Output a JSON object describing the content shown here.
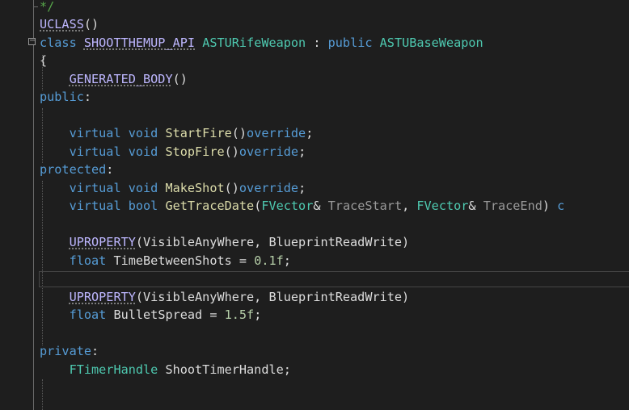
{
  "editor": {
    "colors": {
      "background": "#1e1e1e",
      "keyword": "#569cd6",
      "type": "#4ec9b0",
      "function": "#dcdcaa",
      "macro": "#beb7ff",
      "number": "#b5cea8",
      "parameter": "#9a9a9a",
      "comment": "#57a64a",
      "text": "#dcdcdc"
    },
    "lines": [
      [
        {
          "t": "*/",
          "c": "comment"
        }
      ],
      [
        {
          "t": "UCLASS",
          "c": "macro",
          "sq": true
        },
        {
          "t": "()",
          "c": "plain"
        }
      ],
      [
        {
          "t": "class ",
          "c": "kw"
        },
        {
          "t": "SHOOTTHEMUP_API",
          "c": "macro",
          "sq": true
        },
        {
          "t": " ",
          "c": "plain"
        },
        {
          "t": "ASTURifeWeapon",
          "c": "type"
        },
        {
          "t": " : ",
          "c": "plain"
        },
        {
          "t": "public ",
          "c": "kw"
        },
        {
          "t": "ASTUBaseWeapon",
          "c": "type"
        }
      ],
      [
        {
          "t": "{",
          "c": "plain"
        }
      ],
      [
        {
          "t": "    ",
          "c": "plain"
        },
        {
          "t": "GENERATED_BODY",
          "c": "macro",
          "sq": true
        },
        {
          "t": "()",
          "c": "plain"
        }
      ],
      [
        {
          "t": "public",
          "c": "kw"
        },
        {
          "t": ":",
          "c": "plain"
        }
      ],
      [],
      [
        {
          "t": "    ",
          "c": "plain"
        },
        {
          "t": "virtual void ",
          "c": "kw"
        },
        {
          "t": "StartFire",
          "c": "fn"
        },
        {
          "t": "()",
          "c": "plain"
        },
        {
          "t": "override",
          "c": "kw"
        },
        {
          "t": ";",
          "c": "plain"
        }
      ],
      [
        {
          "t": "    ",
          "c": "plain"
        },
        {
          "t": "virtual void ",
          "c": "kw"
        },
        {
          "t": "StopFire",
          "c": "fn"
        },
        {
          "t": "()",
          "c": "plain"
        },
        {
          "t": "override",
          "c": "kw"
        },
        {
          "t": ";",
          "c": "plain"
        }
      ],
      [
        {
          "t": "protected",
          "c": "kw"
        },
        {
          "t": ":",
          "c": "plain"
        }
      ],
      [
        {
          "t": "    ",
          "c": "plain"
        },
        {
          "t": "virtual void ",
          "c": "kw"
        },
        {
          "t": "MakeShot",
          "c": "fn"
        },
        {
          "t": "()",
          "c": "plain"
        },
        {
          "t": "override",
          "c": "kw"
        },
        {
          "t": ";",
          "c": "plain"
        }
      ],
      [
        {
          "t": "    ",
          "c": "plain"
        },
        {
          "t": "virtual bool ",
          "c": "kw"
        },
        {
          "t": "GetTraceDate",
          "c": "fn"
        },
        {
          "t": "(",
          "c": "plain"
        },
        {
          "t": "FVector",
          "c": "type"
        },
        {
          "t": "& ",
          "c": "plain"
        },
        {
          "t": "TraceStart",
          "c": "param"
        },
        {
          "t": ", ",
          "c": "plain"
        },
        {
          "t": "FVector",
          "c": "type"
        },
        {
          "t": "& ",
          "c": "plain"
        },
        {
          "t": "TraceEnd",
          "c": "param"
        },
        {
          "t": ") ",
          "c": "plain"
        },
        {
          "t": "c",
          "c": "kw"
        }
      ],
      [],
      [
        {
          "t": "    ",
          "c": "plain"
        },
        {
          "t": "UPROPERTY",
          "c": "macro",
          "sq": true
        },
        {
          "t": "(VisibleAnyWhere, BlueprintReadWrite)",
          "c": "plain"
        }
      ],
      [
        {
          "t": "    ",
          "c": "plain"
        },
        {
          "t": "float ",
          "c": "kw"
        },
        {
          "t": "TimeBetweenShots = ",
          "c": "plain"
        },
        {
          "t": "0.1f",
          "c": "num"
        },
        {
          "t": ";",
          "c": "plain"
        }
      ],
      [],
      [
        {
          "t": "    ",
          "c": "plain"
        },
        {
          "t": "UPROPERTY",
          "c": "macro",
          "sq": true
        },
        {
          "t": "(VisibleAnyWhere, BlueprintReadWrite)",
          "c": "plain"
        }
      ],
      [
        {
          "t": "    ",
          "c": "plain"
        },
        {
          "t": "float ",
          "c": "kw"
        },
        {
          "t": "BulletSpread = ",
          "c": "plain"
        },
        {
          "t": "1.5f",
          "c": "num"
        },
        {
          "t": ";",
          "c": "plain"
        }
      ],
      [],
      [
        {
          "t": "private",
          "c": "kw"
        },
        {
          "t": ":",
          "c": "plain"
        }
      ],
      [
        {
          "t": "    ",
          "c": "plain"
        },
        {
          "t": "FTimerHandle ",
          "c": "type"
        },
        {
          "t": "ShootTimerHandle;",
          "c": "plain"
        }
      ],
      [],
      []
    ]
  }
}
